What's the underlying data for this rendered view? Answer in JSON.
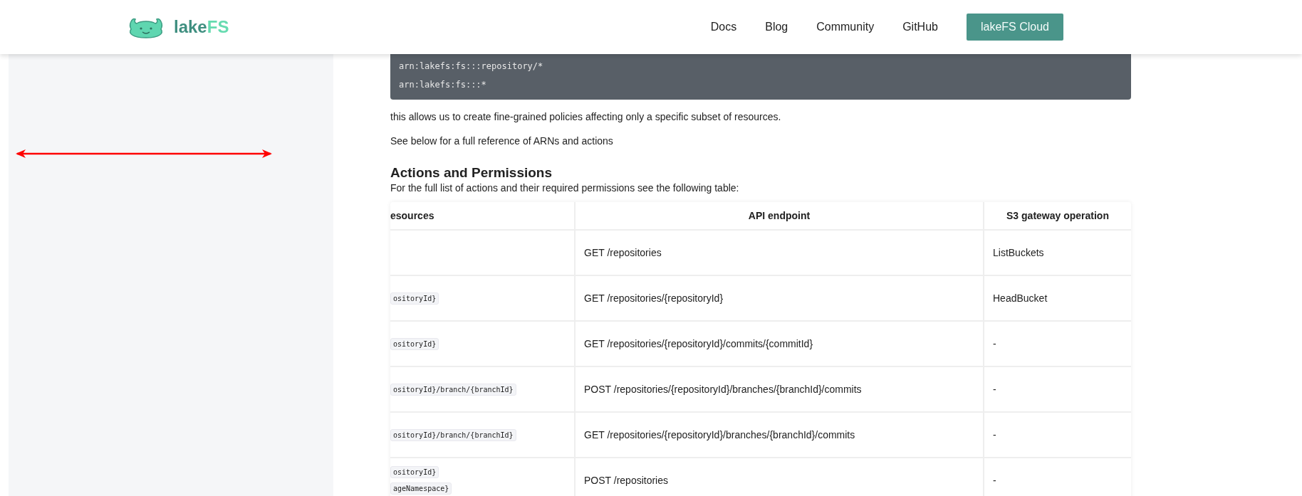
{
  "header": {
    "logo": {
      "text": "lake",
      "accent": "FS"
    },
    "nav": [
      {
        "label": "Docs"
      },
      {
        "label": "Blog"
      },
      {
        "label": "Community"
      },
      {
        "label": "GitHub"
      }
    ],
    "cta": "lakeFS Cloud"
  },
  "content": {
    "code_lines": [
      "arn:lakefs:fs:::repository/*",
      "arn:lakefs:fs:::*"
    ],
    "paragraphs": [
      "this allows us to create fine-grained policies affecting only a specific subset of resources.",
      "See below for a full reference of ARNs and actions"
    ],
    "section_heading": "Actions and Permissions",
    "section_intro": "For the full list of actions and their required permissions see the following table:",
    "table": {
      "columns": [
        "esources",
        "API endpoint",
        "S3 gateway operation"
      ],
      "rows": [
        {
          "resources": [],
          "api": "GET /repositories",
          "s3": "ListBuckets"
        },
        {
          "resources": [
            "ositoryId}"
          ],
          "api": "GET /repositories/{repositoryId}",
          "s3": "HeadBucket"
        },
        {
          "resources": [
            "ositoryId}"
          ],
          "api": "GET /repositories/{repositoryId}/commits/{commitId}",
          "s3": "-"
        },
        {
          "resources": [
            "ositoryId}/branch/{branchId}"
          ],
          "api": "POST /repositories/{repositoryId}/branches/{branchId}/commits",
          "s3": "-"
        },
        {
          "resources": [
            "ositoryId}/branch/{branchId}"
          ],
          "api": "GET /repositories/{repositoryId}/branches/{branchId}/commits",
          "s3": "-"
        },
        {
          "resources": [
            "ositoryId}",
            "ageNamespace}"
          ],
          "api": "POST /repositories",
          "s3": "-"
        }
      ]
    }
  }
}
